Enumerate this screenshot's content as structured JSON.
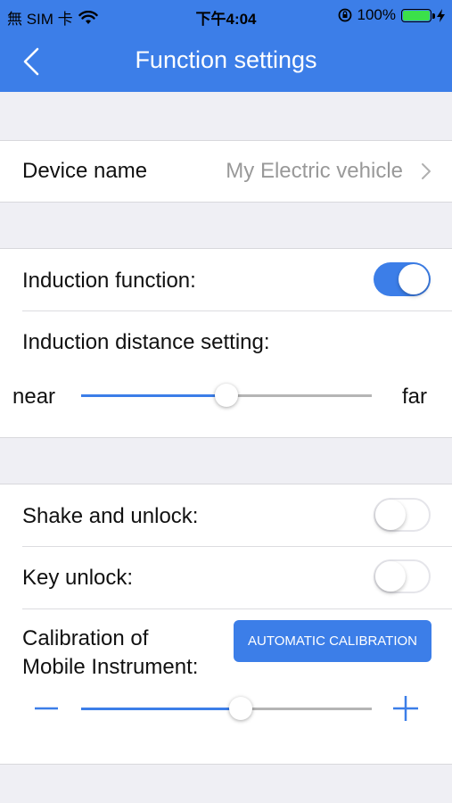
{
  "status_bar": {
    "carrier": "無 SIM 卡",
    "time": "下午4:04",
    "battery": "100%",
    "battery_color": "#3be04a"
  },
  "header": {
    "title": "Function settings",
    "back_icon": "chevron-left-icon",
    "color": "#3c7ee8"
  },
  "device": {
    "label": "Device name",
    "value": "My Electric vehicle"
  },
  "induction": {
    "function_label": "Induction function:",
    "function_enabled": true,
    "distance_label": "Induction distance setting:",
    "near_label": "near",
    "far_label": "far",
    "distance_level": 0.5
  },
  "unlock": {
    "shake_label": "Shake and unlock:",
    "shake_enabled": false,
    "key_label": "Key unlock:",
    "key_enabled": false
  },
  "calibration": {
    "label_line1": "Calibration of",
    "label_line2": "Mobile Instrument:",
    "auto_button": "AUTOMATIC CALIBRATION",
    "minus_label": "—",
    "plus_label": "+",
    "level": 0.55
  }
}
